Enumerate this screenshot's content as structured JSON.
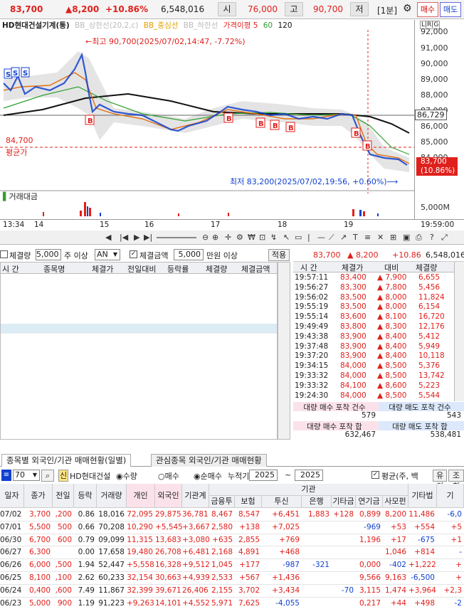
{
  "topbar": {
    "price": "83,700",
    "change": "▲8,200",
    "change_pct": "+10.86%",
    "volume": "6,548,016",
    "open_label": "시",
    "open": "76,000",
    "high_label": "고",
    "high": "90,700",
    "low_label": "저",
    "interval": "[1분]",
    "buy_label": "매수",
    "sell_label": "매도"
  },
  "chart": {
    "legend": {
      "name": "HD현대건설기계(통)",
      "bb_upper": "BB_상한선(20,2,c)",
      "bb_mid": "BB_중심선",
      "bb_lower": "BB_하한선",
      "ma": "가격이평 5",
      "ma60": "60",
      "ma120": "120",
      "corner": "L|R|G"
    },
    "price_ticks": [
      "92,000",
      "91,000",
      "90,000",
      "89,000",
      "88,000",
      "87,000",
      "86,000",
      "85,000",
      "84,000"
    ],
    "current_line_label": "86,729",
    "last_price_label": "83,700",
    "last_price_pct": "(10.86%)",
    "avg_price": "84,700",
    "avg_label": "평균가",
    "high_note": "←최고 90,700(2025/07/02,14:47, -7.72%)",
    "low_note": "최저 83,200(2025/07/02,19:56, +0.60%)⟶",
    "volume_label": "거래대금",
    "volume_tick": "5,000M",
    "time_start": "13:34",
    "time_ticks": [
      "14",
      "15",
      "16",
      "17",
      "18",
      "19"
    ],
    "time_end": "19:59:00",
    "colors": {
      "candle_up": "#e0201c",
      "candle_down": "#1040d0",
      "ma5": "#e07010",
      "ma60": "#30a030",
      "ma120": "#111111",
      "bb_fill": "#d8d8d8"
    }
  },
  "filter": {
    "qty_label": "체결량",
    "qty_value": "5,000",
    "qty_unit": "주 이상",
    "select_value": "AN",
    "amount_label": "체결금액",
    "amount_value": "5,000",
    "amount_unit": "만원 이상",
    "apply_label": "적용"
  },
  "left_table": {
    "headers": [
      "시 간",
      "종목명",
      "체결가",
      "전일대비",
      "등락률",
      "체결량",
      "체결금액"
    ]
  },
  "right_panel": {
    "price": "83,700",
    "change": "▲ 8,200",
    "pct": "+10.86",
    "volume": "6,548,016",
    "headers": [
      "시 간",
      "체결가",
      "대비",
      "체결량"
    ],
    "rows": [
      {
        "time": "19:57:11",
        "price": "83,400",
        "diff": "▲ 7,900",
        "qty": "6,655"
      },
      {
        "time": "19:56:27",
        "price": "83,300",
        "diff": "▲ 7,800",
        "qty": "5,456"
      },
      {
        "time": "19:56:02",
        "price": "83,500",
        "diff": "▲ 8,000",
        "qty": "11,824"
      },
      {
        "time": "19:55:19",
        "price": "83,500",
        "diff": "▲ 8,000",
        "qty": "6,154"
      },
      {
        "time": "19:55:14",
        "price": "83,600",
        "diff": "▲ 8,100",
        "qty": "16,720"
      },
      {
        "time": "19:49:49",
        "price": "83,800",
        "diff": "▲ 8,300",
        "qty": "12,176"
      },
      {
        "time": "19:43:38",
        "price": "83,900",
        "diff": "▲ 8,400",
        "qty": "5,412"
      },
      {
        "time": "19:37:48",
        "price": "83,900",
        "diff": "▲ 8,400",
        "qty": "5,949"
      },
      {
        "time": "19:37:20",
        "price": "83,900",
        "diff": "▲ 8,400",
        "qty": "10,118"
      },
      {
        "time": "19:34:15",
        "price": "84,000",
        "diff": "▲ 8,500",
        "qty": "5,376"
      },
      {
        "time": "19:33:32",
        "price": "84,000",
        "diff": "▲ 8,500",
        "qty": "13,742"
      },
      {
        "time": "19:33:32",
        "price": "84,100",
        "diff": "▲ 8,600",
        "qty": "5,223"
      },
      {
        "time": "19:24:30",
        "price": "84,000",
        "diff": "▲ 8,500",
        "qty": "5,544"
      }
    ],
    "summary": {
      "buy_count_label": "대량 매수 포착 건수",
      "sell_count_label": "대량 매도 포착 건수",
      "buy_count": "579",
      "sell_count": "543",
      "buy_sum_label": "대량 매수 포착 합",
      "sell_sum_label": "대량 매도 포착 합",
      "buy_sum": "632,467",
      "sell_sum": "538,481"
    }
  },
  "bottom": {
    "tabs": [
      "종목별 외국인/기관 매매현황(일별)",
      "관심종목 외국인/기관 매매현황"
    ],
    "code": "70",
    "stock_name": "HD현대건설",
    "radio1": "수량",
    "radio2": "매수",
    "radio3": "순매수",
    "period_label": "누적기간",
    "year_from": "2025",
    "year_to": "2025",
    "avg_check": "평균(주, 백",
    "btn_a": "유의",
    "btn_b": "조회",
    "headers_top": {
      "inst": "기관"
    },
    "headers": [
      "일자",
      "종가",
      "전일",
      "등락",
      "거래량",
      "개인",
      "외국인",
      "기관계",
      "금융투",
      "보험",
      "투신",
      "은행",
      "기타금",
      "연기금",
      "사모펀",
      "기타법",
      "기"
    ],
    "rows": [
      {
        "date": "07/02",
        "close": "3,700",
        "prev": ",200",
        "chg": "0.86",
        "vol": "18,016",
        "ind": "72,095",
        "for": "29,875",
        "inst": "36,781",
        "fin": "8,467",
        "ins": "8,547",
        "trust": "+6,451",
        "bank": "1,883",
        "etc": "+128",
        "pen": "0,899",
        "pef": "8,200",
        "corp": "11,486",
        "g": "-6,0"
      },
      {
        "date": "07/01",
        "close": "5,500",
        "prev": "500",
        "chg": "0.66",
        "vol": "70,208",
        "ind": "10,290",
        "for": "+5,545",
        "inst": "+3,667",
        "fin": "2,580",
        "ins": "+138",
        "trust": "+7,025",
        "bank": "",
        "etc": "",
        "pen": "-969",
        "pef": "+53",
        "corp": "+554",
        "g": "+5"
      },
      {
        "date": "06/30",
        "close": "6,700",
        "prev": "600",
        "chg": "0.79",
        "vol": "09,099",
        "ind": "11,315",
        "for": "13,683",
        "inst": "+3,080",
        "fin": "+635",
        "ins": "2,855",
        "trust": "+769",
        "bank": "",
        "etc": "",
        "pen": "1,196",
        "pef": "+17",
        "corp": "-675",
        "g": "+1"
      },
      {
        "date": "06/27",
        "close": "6,300",
        "prev": "",
        "chg": "0.00",
        "vol": "17,658",
        "ind": "19,480",
        "for": "26,708",
        "inst": "+6,481",
        "fin": "2,168",
        "ins": "4,891",
        "trust": "+468",
        "bank": "",
        "etc": "",
        "pen": "",
        "pef": "1,046",
        "corp": "+814",
        "g": "-"
      },
      {
        "date": "06/26",
        "close": "6,000",
        "prev": ",500",
        "chg": "1.94",
        "vol": "52,447",
        "ind": "+5,558",
        "for": "16,328",
        "inst": "+9,512",
        "fin": "1,045",
        "ins": "+177",
        "trust": "-987",
        "bank": "-321",
        "etc": "",
        "pen": "0,000",
        "pef": "-402",
        "corp": "+1,222",
        "g": "+"
      },
      {
        "date": "06/25",
        "close": "8,100",
        "prev": ",100",
        "chg": "2.62",
        "vol": "60,233",
        "ind": "32,154",
        "for": "30,663",
        "inst": "+4,939",
        "fin": "2,533",
        "ins": "+567",
        "trust": "+1,436",
        "bank": "",
        "etc": "",
        "pen": "9,566",
        "pef": "9,163",
        "corp": "-6,500",
        "g": "+"
      },
      {
        "date": "06/24",
        "close": "0,400",
        "prev": ",600",
        "chg": "7.49",
        "vol": "11,867",
        "ind": "32,399",
        "for": "39,671",
        "inst": "26,406",
        "fin": "2,155",
        "ins": "3,702",
        "trust": "+3,434",
        "bank": "",
        "etc": "-70",
        "pen": "3,115",
        "pef": "1,474",
        "corp": "+3,964",
        "g": "+2,3"
      },
      {
        "date": "06/23",
        "close": "5,000",
        "prev": "900",
        "chg": "1.19",
        "vol": "91,223",
        "ind": "+9,263",
        "for": "14,101",
        "inst": "+4,552",
        "fin": "5,971",
        "ins": "7,625",
        "trust": "-4,055",
        "bank": "",
        "etc": "",
        "pen": "0,217",
        "pef": "+44",
        "corp": "+498",
        "g": "-2"
      }
    ]
  }
}
